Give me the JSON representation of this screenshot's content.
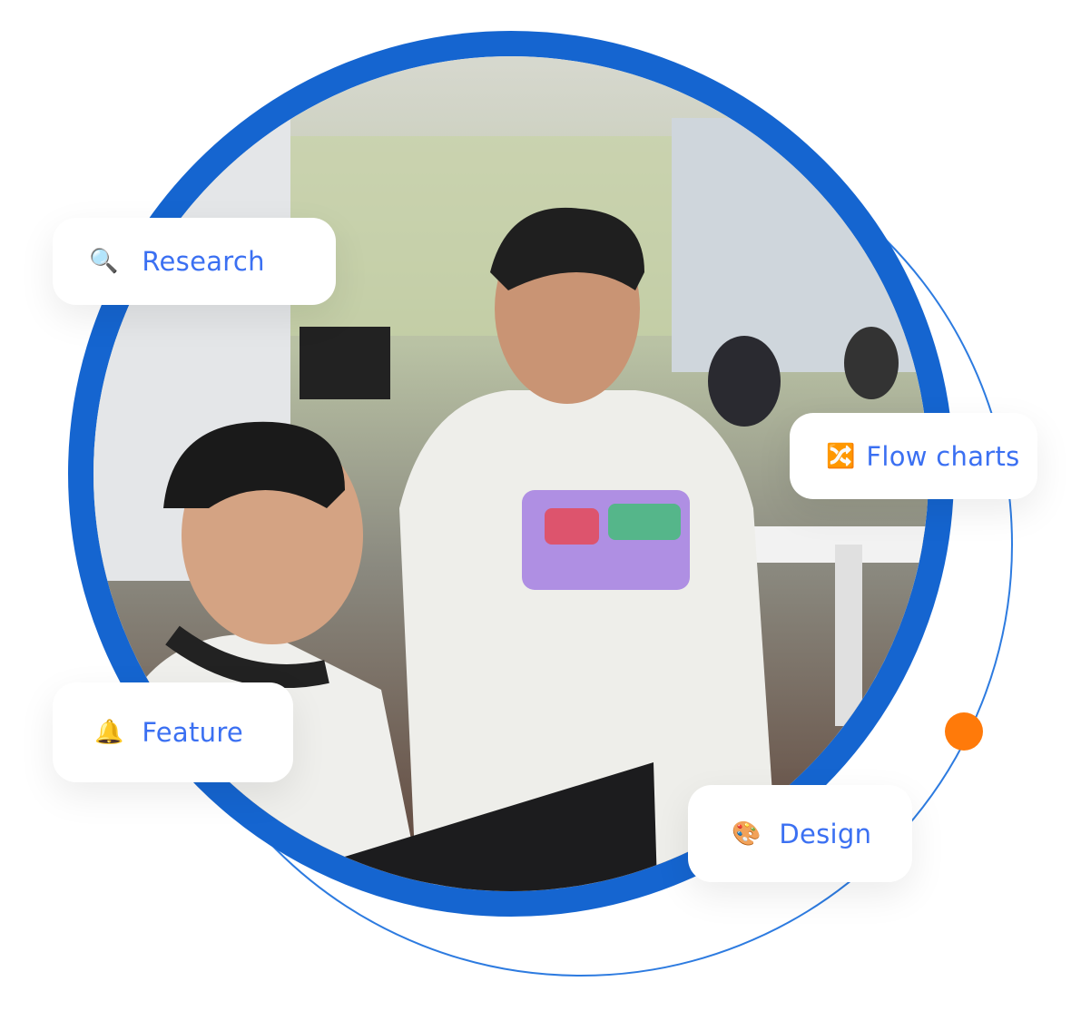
{
  "colors": {
    "ring": "#1565d0",
    "accent_text": "#3b70f2",
    "dot": "#ff7a0a",
    "thin_arc": "#2d7be0"
  },
  "cards": [
    {
      "icon": "magnifier-icon",
      "glyph": "🔍",
      "label": "Research"
    },
    {
      "icon": "shuffle-icon",
      "glyph": "🔀",
      "label": "Flow charts"
    },
    {
      "icon": "bell-icon",
      "glyph": "🔔",
      "label": "Feature"
    },
    {
      "icon": "palette-icon",
      "glyph": "🎨",
      "label": "Design"
    }
  ]
}
